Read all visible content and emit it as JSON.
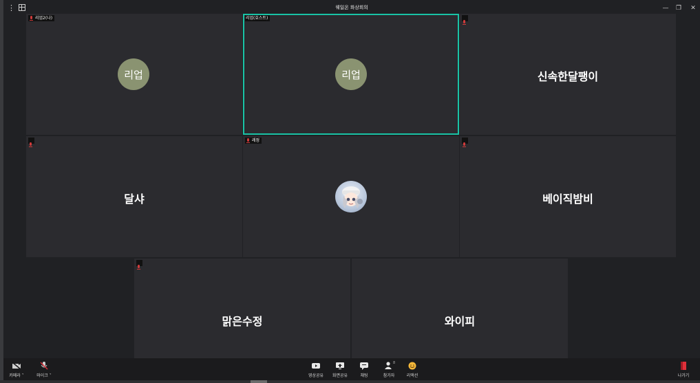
{
  "window": {
    "title": "웨일온 화상회의",
    "menu_glyph": "⋮",
    "minimize": "—",
    "restore": "❐",
    "close": "✕"
  },
  "participants": [
    {
      "tag": "리업2(나)",
      "avatar_text": "리업",
      "kind": "avatar"
    },
    {
      "tag": "리업(호스트)",
      "avatar_text": "리업",
      "kind": "avatar",
      "active": true
    },
    {
      "tag": "",
      "display_name": "신속한달팽이",
      "kind": "name"
    },
    {
      "tag": "",
      "display_name": "달샤",
      "kind": "name"
    },
    {
      "tag": "레정",
      "kind": "image"
    },
    {
      "tag": "",
      "display_name": "베이직밤비",
      "kind": "name"
    },
    {
      "tag": "",
      "display_name": "맑은수정",
      "kind": "name"
    },
    {
      "tag": "",
      "display_name": "와이피",
      "kind": "name"
    }
  ],
  "toolbar": {
    "camera": "카메라",
    "mic": "마이크",
    "video_share": "영상공유",
    "screen_share": "화면공유",
    "chat": "채팅",
    "participants": "참가자",
    "participants_count": "8",
    "reaction": "리액션",
    "leave": "나가기"
  },
  "colors": {
    "active_border": "#19c3a6",
    "avatar_bg": "#8a9371",
    "mute_red": "#d13b3b",
    "leave_red": "#e0303a"
  }
}
